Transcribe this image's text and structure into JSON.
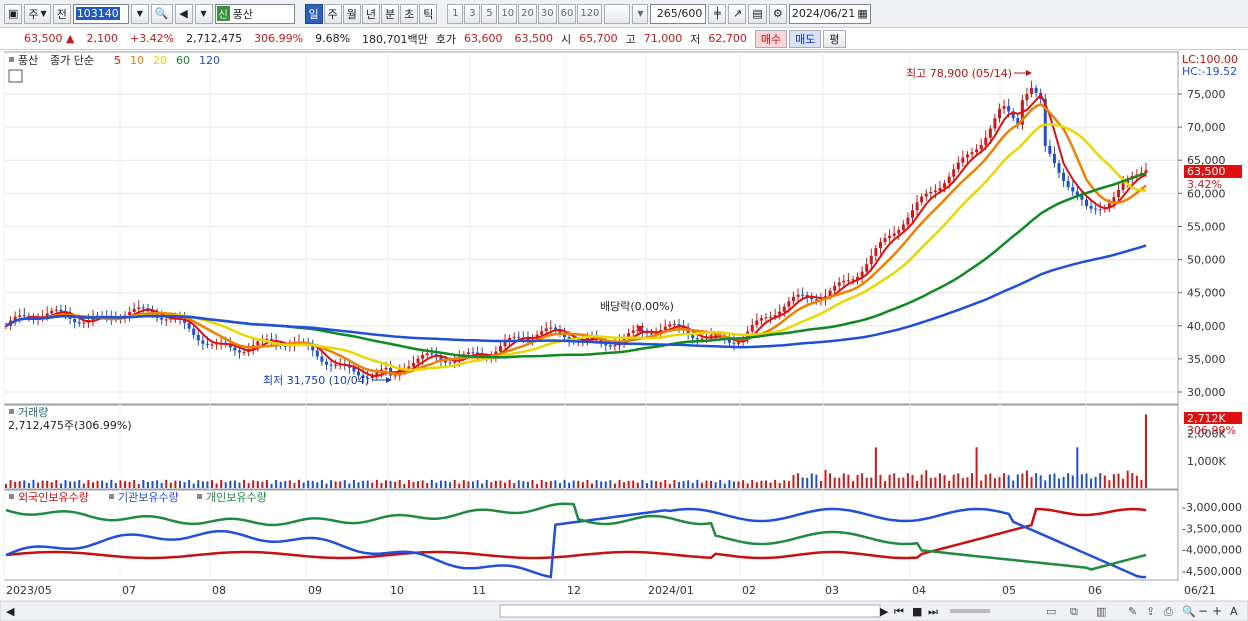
{
  "toolbar": {
    "type_label": "주",
    "prev_label": "전",
    "stock_code": "103140",
    "stock_name": "풍산",
    "name_tag": "신",
    "periods": [
      "일",
      "주",
      "월",
      "년",
      "분",
      "초",
      "틱"
    ],
    "active_period": "일",
    "intervals": [
      "1",
      "3",
      "5",
      "10",
      "20",
      "30",
      "60",
      "120"
    ],
    "count": "265",
    "count_max": "/600",
    "date": "2024/06/21"
  },
  "info": {
    "price": "63,500",
    "arrow": "▲",
    "change": "2,100",
    "change_pct": "+3.42%",
    "volume": "2,712,475",
    "volume_pct": "306.99%",
    "turnover": "9.68%",
    "amount": "180,701백만",
    "ask_label": "호가",
    "ask1": "63,600",
    "ask2": "63,500",
    "open_label": "시",
    "open": "65,700",
    "high_label": "고",
    "high": "71,000",
    "low_label": "저",
    "low": "62,700",
    "buy_label": "매수",
    "sell_label": "매도",
    "eval_label": "평"
  },
  "price_legend": {
    "name": "풍산",
    "title": "종가 단순",
    "ma": [
      {
        "label": "5",
        "color": "#e01010"
      },
      {
        "label": "10",
        "color": "#f08000"
      },
      {
        "label": "20",
        "color": "#e8d800"
      },
      {
        "label": "60",
        "color": "#108a20"
      },
      {
        "label": "120",
        "color": "#2050d8"
      }
    ],
    "lc": "LC:100.00",
    "hc": "HC:-19.52"
  },
  "annotations": {
    "high": "최고 78,900 (05/14)",
    "low": "최저 31,750 (10/04)",
    "dividend": "배당락(0.00%)"
  },
  "price_axis": {
    "ticks": [
      "75,000",
      "70,000",
      "65,000",
      "60,000",
      "55,000",
      "50,000",
      "45,000",
      "40,000",
      "35,000",
      "30,000"
    ],
    "current_price": "63,500",
    "current_pct": "3.42%"
  },
  "volume_panel": {
    "title": "거래량",
    "subtitle": "2,712,475주(306.99%)",
    "ticks": [
      "2,000K",
      "1,000K"
    ],
    "current": "2,712K",
    "current_pct": "306.99%"
  },
  "holding_panel": {
    "legend": [
      {
        "label": "외국인보유수량",
        "color": "#c81010"
      },
      {
        "label": "기관보유수량",
        "color": "#2050d8"
      },
      {
        "label": "개인보유수량",
        "color": "#208a40"
      }
    ],
    "ticks": [
      "-3,000,000",
      "-3,500,000",
      "-4,000,000",
      "-4,500,000"
    ]
  },
  "x_axis": {
    "labels": [
      "2023/05",
      "07",
      "08",
      "09",
      "10",
      "11",
      "12",
      "2024/01",
      "02",
      "03",
      "04",
      "05",
      "06",
      "06/21"
    ]
  },
  "chart_data": {
    "type": "candlestick",
    "title": "풍산",
    "y_range": [
      30000,
      78900
    ],
    "key_points": [
      {
        "label": "최고",
        "date": "05/14",
        "value": 78900
      },
      {
        "label": "최저",
        "date": "10/04",
        "value": 31750
      }
    ],
    "current": {
      "close": 63500,
      "open": 65700,
      "high": 71000,
      "low": 62700,
      "change": 2100,
      "change_pct": 3.42
    },
    "ma_periods": [
      5,
      10,
      20,
      60,
      120
    ],
    "approx_close_by_month": {
      "dates": [
        "2023/05",
        "07",
        "08",
        "09",
        "10",
        "11",
        "12",
        "2024/01",
        "02",
        "03",
        "04",
        "05",
        "06",
        "06/21"
      ],
      "values": [
        40000,
        42500,
        38000,
        36000,
        32500,
        36500,
        38500,
        38500,
        39000,
        45000,
        56000,
        73000,
        58000,
        63500
      ]
    },
    "volume_current": 2712475
  }
}
